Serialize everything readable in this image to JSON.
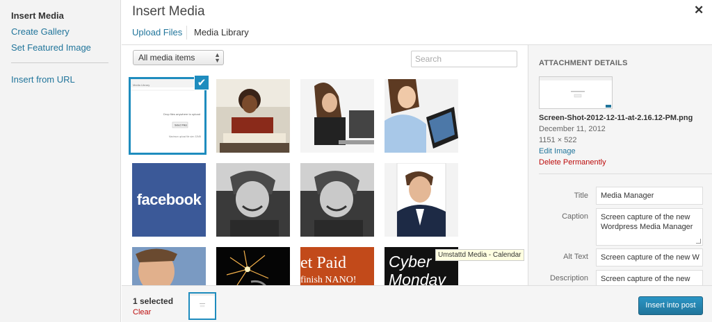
{
  "menu": {
    "items": [
      {
        "label": "Insert Media",
        "active": true
      },
      {
        "label": "Create Gallery"
      },
      {
        "label": "Set Featured Image"
      },
      {
        "label": "Insert from URL"
      }
    ]
  },
  "modal": {
    "title": "Insert Media",
    "close_icon": "close-icon",
    "tabs": [
      {
        "label": "Upload Files"
      },
      {
        "label": "Media Library",
        "active": true
      }
    ]
  },
  "toolbar": {
    "filter_value": "All media items",
    "search_placeholder": "Search"
  },
  "grid": {
    "selected_thumb_caption": "Drop files anywhere to upload",
    "selected_thumb_button": "Select Files",
    "selected_thumb_note": "Maximum upload file size: 32MB",
    "selected_thumb_header": "Media Library",
    "facebook_text": "facebook",
    "tile_11_text_a": "et Paid",
    "tile_11_text_b": "finish NANO!",
    "tile_12_text_a": "Cyber",
    "tile_12_text_b": "Monday",
    "tooltip": "Umstattd Media - Calendar"
  },
  "details": {
    "heading": "ATTACHMENT DETAILS",
    "filename": "Screen-Shot-2012-12-11-at-2.16.12-PM.png",
    "date": "December 11, 2012",
    "dimensions": "1151 × 522",
    "edit_label": "Edit Image",
    "delete_label": "Delete Permanently",
    "fields": {
      "title_label": "Title",
      "title_value": "Media Manager",
      "caption_label": "Caption",
      "caption_value": "Screen capture of the new Wordpress Media Manager",
      "alt_label": "Alt Text",
      "alt_value": "Screen capture of the new W",
      "description_label": "Description",
      "description_value": "Screen capture of the new Wordpress Media Manager"
    }
  },
  "footer": {
    "selected_count": "1 selected",
    "clear_label": "Clear",
    "insert_label": "Insert into post"
  },
  "colors": {
    "accent": "#1e8cbe",
    "link": "#21759b",
    "danger": "#bc0b0b",
    "facebook": "#3b5998"
  }
}
